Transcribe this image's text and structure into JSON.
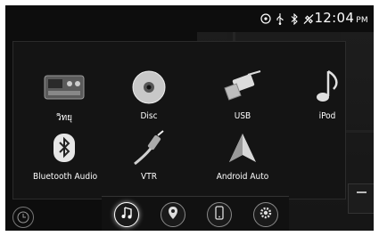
{
  "status": {
    "time": "12:04",
    "ampm": "PM",
    "icons": [
      "disc-status-icon",
      "usb-status-icon",
      "bluetooth-status-icon",
      "signal-mute-icon"
    ]
  },
  "menu": {
    "items": [
      {
        "label": "วิทยุ",
        "icon": "radio-icon"
      },
      {
        "label": "Disc",
        "icon": "disc-icon"
      },
      {
        "label": "USB",
        "icon": "usb-icon"
      },
      {
        "label": "iPod",
        "icon": "music-note-icon"
      },
      {
        "label": "Bluetooth Audio",
        "icon": "bluetooth-icon"
      },
      {
        "label": "VTR",
        "icon": "av-cable-icon"
      },
      {
        "label": "Android Auto",
        "icon": "android-auto-icon"
      }
    ]
  },
  "dock": {
    "buttons": [
      "media-menu-icon",
      "navigation-icon",
      "phone-icon",
      "settings-icon"
    ]
  }
}
